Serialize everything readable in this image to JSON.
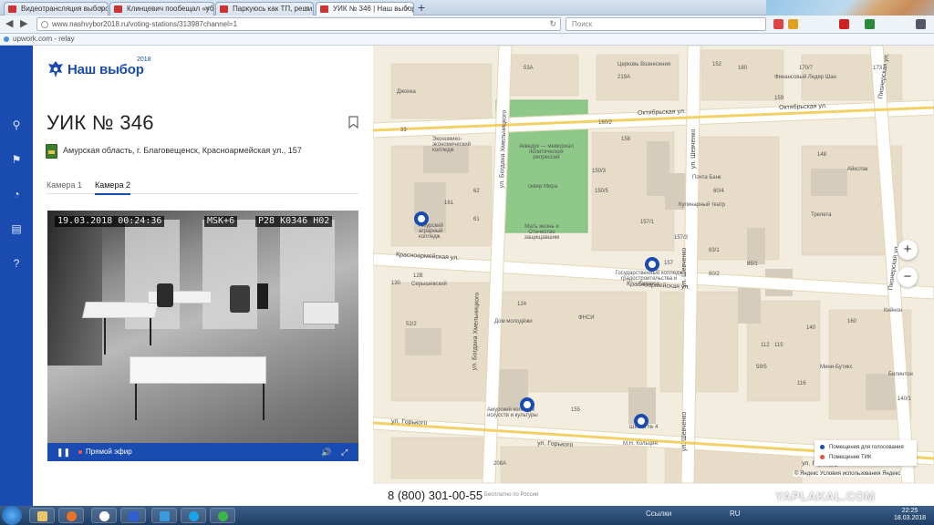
{
  "browser": {
    "tabs": [
      {
        "label": "Видеотрансляция выборо..."
      },
      {
        "label": "Клинцевич пообещал «убр..."
      },
      {
        "label": "Паркуюсь как ТП, решил..."
      },
      {
        "label": "УИК № 346 | Наш выбор..."
      }
    ],
    "new_tab": "+",
    "url": "www.nashvybor2018.ru/voting-stations/313987channel=1",
    "search_placeholder": "Поиск",
    "bookmark": "upwork.com - relay"
  },
  "rail": {
    "icons": [
      "search-icon",
      "bookmark-icon",
      "speed-icon",
      "chat-icon",
      "help-icon"
    ]
  },
  "panel": {
    "logo_text": "Наш выбор",
    "logo_year": "2018",
    "title": "УИК № 346",
    "address": "Амурская область, г. Благовещенск, Красноармейская ул., 157",
    "tabs": [
      "Камера 1",
      "Камера 2"
    ],
    "active_tab": "Камера 2"
  },
  "video": {
    "timestamp": "19.03.2018 00:24:36",
    "timezone": "MSK+6",
    "camera_code": "P28 K0346 H02",
    "play_label": "❚❚",
    "live_label": "Прямой эфир",
    "volume_label": "🔊",
    "fullscreen_label": "⤢"
  },
  "map": {
    "streets": [
      {
        "text": "Октябрьская ул."
      },
      {
        "text": "Октябрьская ул."
      },
      {
        "text": "Красноармейская ул."
      },
      {
        "text": "Красноармейская ул."
      },
      {
        "text": "ул. Горького"
      },
      {
        "text": "ул. Горького"
      },
      {
        "text": "ул. Горького"
      },
      {
        "text": "ул. Богдана Хмельницкого"
      },
      {
        "text": "ул. Богдана Хмельницкого"
      },
      {
        "text": "ул. Шевченко"
      },
      {
        "text": "ул. Шевченко"
      },
      {
        "text": "ул. Шевченко"
      },
      {
        "text": "Пионерская ул."
      },
      {
        "text": "Пионерская ул."
      }
    ],
    "places": [
      {
        "text": "Церковь Вознесения"
      },
      {
        "text": "Джонка"
      },
      {
        "text": "Финансовый Ледяр Шан"
      },
      {
        "text": "Акведук — мемориал политических репрессий"
      },
      {
        "text": "сквер Мира"
      },
      {
        "text": "Мать жизнь и Отечество защищавшим"
      },
      {
        "text": "Экономико-экономический колледж"
      },
      {
        "text": "Амурский аграрный колледж"
      },
      {
        "text": "Серышевский"
      },
      {
        "text": "Государственный колледж градостроительства и бизнеса"
      },
      {
        "text": "Почта Банк"
      },
      {
        "text": "Кулинарный театр"
      },
      {
        "text": "Трелета"
      },
      {
        "text": "Айкслак"
      },
      {
        "text": "Дом молодёжи"
      },
      {
        "text": "ФНСИ"
      },
      {
        "text": "Амурский колледж искусств и культуры"
      },
      {
        "text": "Школа № 4"
      },
      {
        "text": "М.Н. Кольцин"
      },
      {
        "text": "Мини-Бутикс"
      },
      {
        "text": "Билинтон"
      },
      {
        "text": "Кийнон"
      }
    ],
    "numbers": [
      "53А",
      "219А",
      "180",
      "152",
      "170/7",
      "173",
      "159",
      "160/2",
      "158",
      "150/3",
      "150/5",
      "157/1",
      "157",
      "157/3",
      "161",
      "62",
      "61",
      "12В",
      "130",
      "52/2",
      "124",
      "112",
      "140",
      "115",
      "116",
      "155",
      "208А",
      "148",
      "85/1",
      "83/1",
      "80/2",
      "60/4",
      "160",
      "140/1",
      "59/5",
      "33"
    ],
    "zoom_in": "+",
    "zoom_out": "−",
    "legend": [
      "Помещения для голосования",
      "Помещение ТИК"
    ],
    "legend_colors": [
      "#1a4bb0",
      "#e74c3c"
    ],
    "copyright": "© Яндекс Условия использования   Яндекс"
  },
  "footer": {
    "phone": "8 (800) 301-00-55",
    "phone_note": "Бесплатно по России"
  },
  "watermark": "YAPLAKAL.COM",
  "taskbar": {
    "links": "Ссылки",
    "lang": "RU",
    "time": "22:25",
    "date": "18.03.2018"
  }
}
